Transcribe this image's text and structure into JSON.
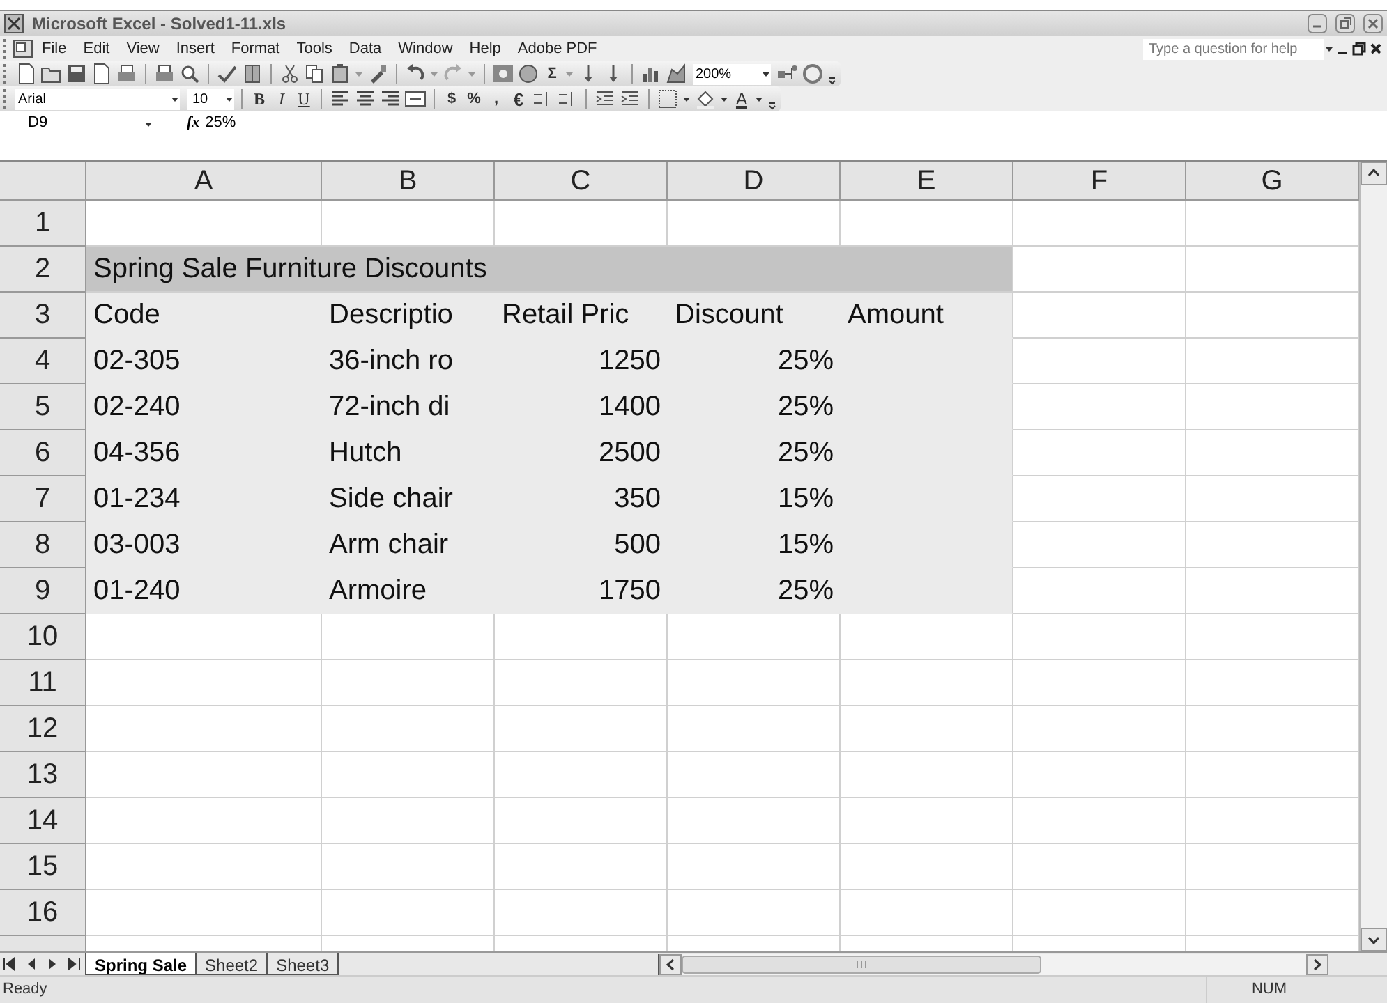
{
  "window": {
    "title": "Microsoft Excel - Solved1-11.xls"
  },
  "menu": [
    "File",
    "Edit",
    "View",
    "Insert",
    "Format",
    "Tools",
    "Data",
    "Window",
    "Help",
    "Adobe PDF"
  ],
  "help_box": {
    "placeholder": "Type a question for help"
  },
  "standard_toolbar": {
    "sum": "Σ",
    "zoom": "200%"
  },
  "formatting_toolbar": {
    "font": "Arial",
    "size": "10",
    "bold": "B",
    "italic": "I",
    "underline": "U",
    "currency": "$",
    "percent": "%",
    "comma": ",",
    "euro": "€",
    "font_color": "A"
  },
  "formula_bar": {
    "name_box": "D9",
    "fx": "fx",
    "value": "25%"
  },
  "columns": [
    "A",
    "B",
    "C",
    "D",
    "E",
    "F",
    "G"
  ],
  "rows": [
    {
      "header": "1",
      "cells": {}
    },
    {
      "header": "2",
      "kind": "title",
      "cells": {
        "A": {
          "text": "Spring Sale Furniture Discounts"
        }
      }
    },
    {
      "header": "3",
      "kind": "body",
      "cells": {
        "A": {
          "text": "Code"
        },
        "B": {
          "text": "Descriptio"
        },
        "C": {
          "text": "Retail Pric"
        },
        "D": {
          "text": "Discount"
        },
        "E": {
          "text": "Amount"
        }
      }
    },
    {
      "header": "4",
      "kind": "body",
      "cells": {
        "A": {
          "text": "02-305"
        },
        "B": {
          "text": "36-inch ro"
        },
        "C": {
          "text": "1250",
          "kind": "number"
        },
        "D": {
          "text": "25%",
          "kind": "number"
        }
      }
    },
    {
      "header": "5",
      "kind": "body",
      "cells": {
        "A": {
          "text": "02-240"
        },
        "B": {
          "text": "72-inch di"
        },
        "C": {
          "text": "1400",
          "kind": "number"
        },
        "D": {
          "text": "25%",
          "kind": "number"
        }
      }
    },
    {
      "header": "6",
      "kind": "body",
      "cells": {
        "A": {
          "text": "04-356"
        },
        "B": {
          "text": "Hutch"
        },
        "C": {
          "text": "2500",
          "kind": "number"
        },
        "D": {
          "text": "25%",
          "kind": "number"
        }
      }
    },
    {
      "header": "7",
      "kind": "body",
      "cells": {
        "A": {
          "text": "01-234"
        },
        "B": {
          "text": "Side chair"
        },
        "C": {
          "text": "350",
          "kind": "number"
        },
        "D": {
          "text": "15%",
          "kind": "number"
        }
      }
    },
    {
      "header": "8",
      "kind": "body",
      "cells": {
        "A": {
          "text": "03-003"
        },
        "B": {
          "text": "Arm chair"
        },
        "C": {
          "text": "500",
          "kind": "number"
        },
        "D": {
          "text": "15%",
          "kind": "number"
        }
      }
    },
    {
      "header": "9",
      "kind": "body",
      "cells": {
        "A": {
          "text": "01-240"
        },
        "B": {
          "text": "Armoire"
        },
        "C": {
          "text": "1750",
          "kind": "number"
        },
        "D": {
          "text": "25%",
          "kind": "number"
        }
      }
    },
    {
      "header": "10",
      "cells": {}
    },
    {
      "header": "11",
      "cells": {}
    },
    {
      "header": "12",
      "cells": {}
    },
    {
      "header": "13",
      "cells": {}
    },
    {
      "header": "14",
      "cells": {}
    },
    {
      "header": "15",
      "cells": {}
    },
    {
      "header": "16",
      "cells": {}
    }
  ],
  "sheet_tabs": [
    {
      "label": "Spring Sale",
      "selected": true
    },
    {
      "label": "Sheet2",
      "selected": false
    },
    {
      "label": "Sheet3",
      "selected": false
    }
  ],
  "status_bar": {
    "mode": "Ready",
    "num": "NUM"
  }
}
